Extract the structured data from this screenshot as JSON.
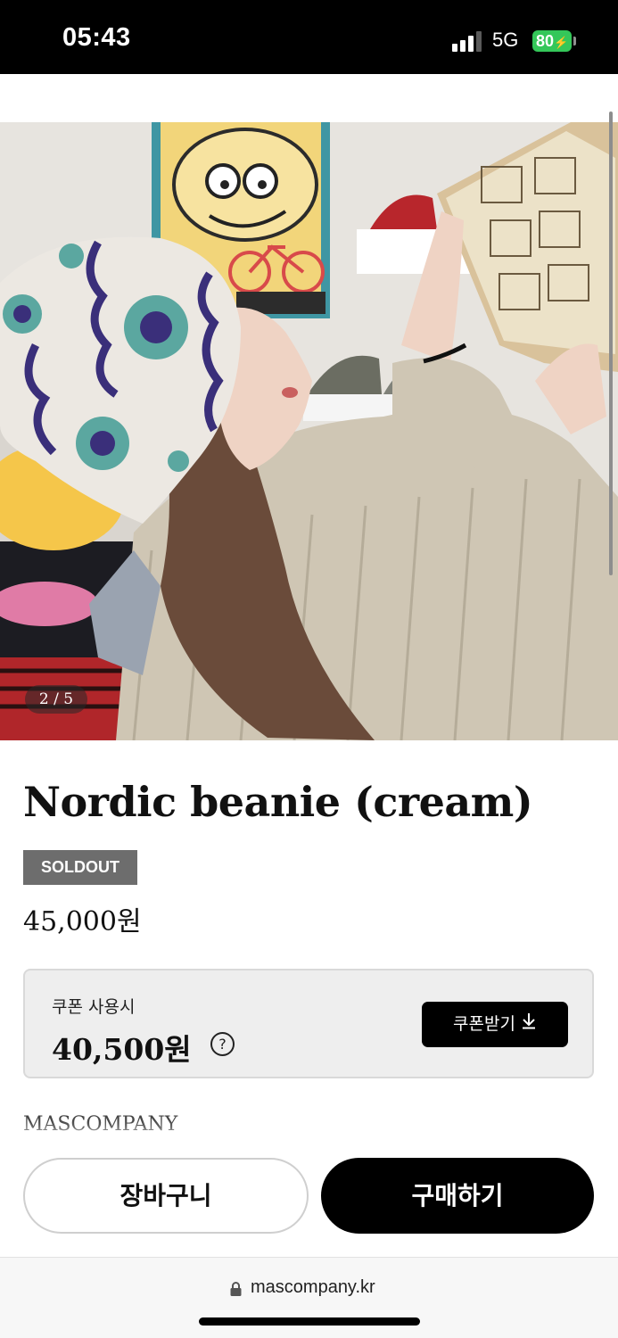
{
  "status_bar": {
    "time": "05:43",
    "network": "5G",
    "battery": "80",
    "battery_color": "#34c759"
  },
  "gallery": {
    "image_alt": "Woman wearing a cream Nordic knit beanie reading a comic book",
    "counter": "2 / 5"
  },
  "product": {
    "title": "Nordic beanie (cream)",
    "badge": "SOLDOUT",
    "price": "45,000원",
    "brand": "MASCOMPANY"
  },
  "coupon": {
    "label": "쿠폰 사용시",
    "price": "40,500원",
    "help_icon": "?",
    "button_label": "쿠폰받기",
    "button_icon": "download-icon"
  },
  "actions": {
    "cart_label": "장바구니",
    "buy_label": "구매하기"
  },
  "browser": {
    "url": "mascompany.kr",
    "lock_icon": "lock-icon"
  }
}
